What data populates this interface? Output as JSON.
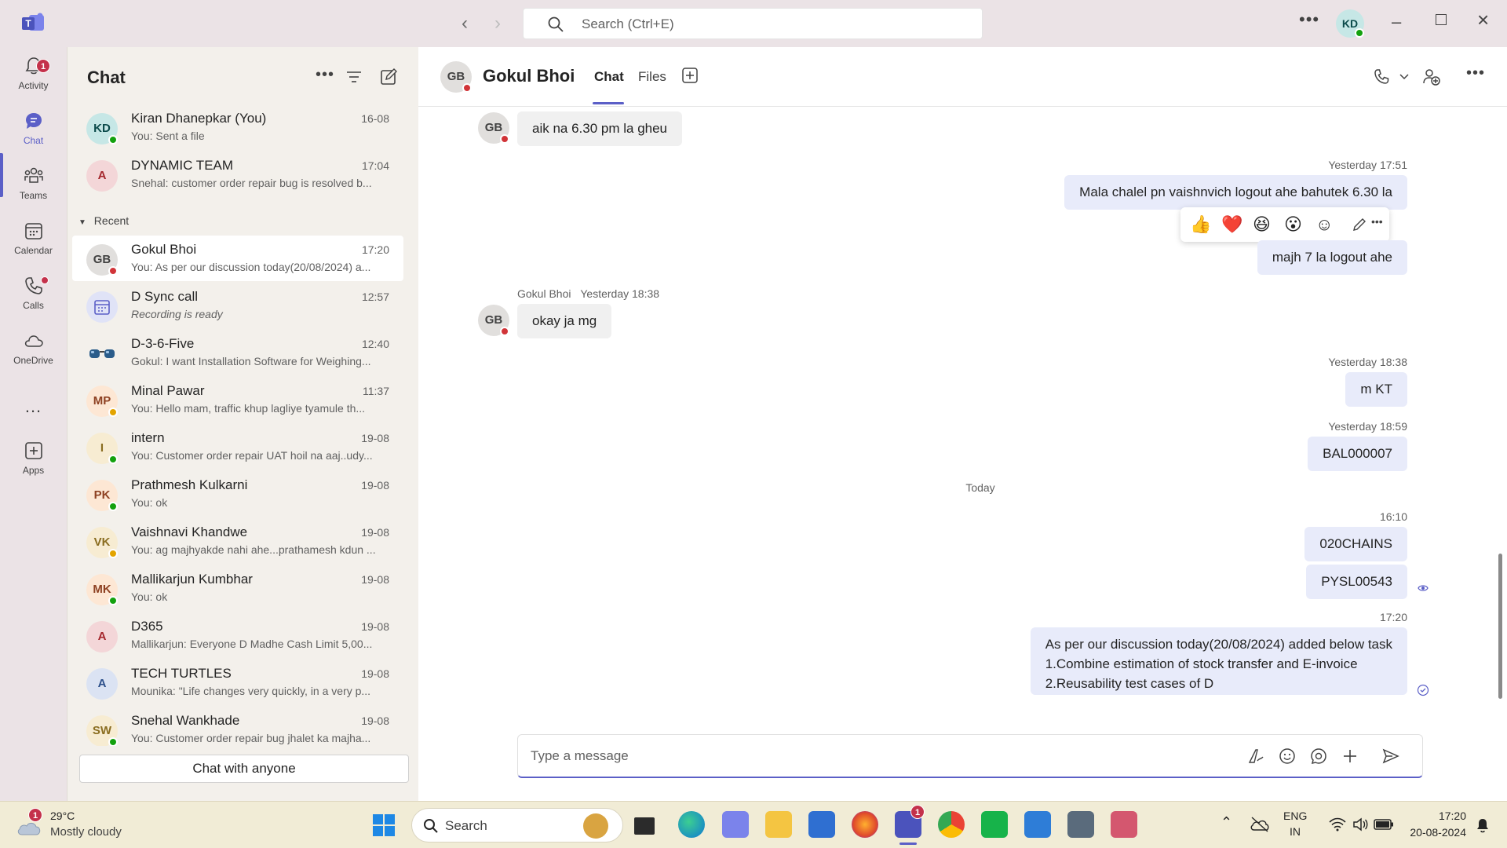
{
  "titlebar": {
    "search_placeholder": "Search (Ctrl+E)",
    "user_initials": "KD"
  },
  "rail": {
    "items": [
      {
        "label": "Activity",
        "badge": "1"
      },
      {
        "label": "Chat"
      },
      {
        "label": "Teams"
      },
      {
        "label": "Calendar"
      },
      {
        "label": "Calls"
      },
      {
        "label": "OneDrive"
      },
      {
        "label": "..."
      },
      {
        "label": "Apps"
      }
    ]
  },
  "chatlist": {
    "title": "Chat",
    "recent_label": "Recent",
    "chat_with_anyone": "Chat with anyone",
    "pinned": [
      {
        "initials": "KD",
        "name": "Kiran Dhanepkar (You)",
        "time": "16-08",
        "preview": "You: Sent a file"
      },
      {
        "initials": "A",
        "name": "DYNAMIC TEAM",
        "time": "17:04",
        "preview": "Snehal: customer order repair bug is resolved b..."
      }
    ],
    "recent": [
      {
        "initials": "GB",
        "name": "Gokul Bhoi",
        "time": "17:20",
        "preview": "You: As per our discussion today(20/08/2024) a..."
      },
      {
        "initials": "",
        "name": "D Sync call",
        "time": "12:57",
        "preview": "Recording is ready"
      },
      {
        "initials": "",
        "name": "D-3-6-Five",
        "time": "12:40",
        "preview": "Gokul: I want Installation Software for Weighing..."
      },
      {
        "initials": "MP",
        "name": "Minal Pawar",
        "time": "11:37",
        "preview": "You: Hello mam, traffic khup lagliye tyamule th..."
      },
      {
        "initials": "I",
        "name": "intern",
        "time": "19-08",
        "preview": "You: Customer order repair UAT hoil na aaj..udy..."
      },
      {
        "initials": "PK",
        "name": "Prathmesh Kulkarni",
        "time": "19-08",
        "preview": "You: ok"
      },
      {
        "initials": "VK",
        "name": "Vaishnavi Khandwe",
        "time": "19-08",
        "preview": "You: ag majhyakde nahi ahe...prathamesh kdun ..."
      },
      {
        "initials": "MK",
        "name": "Mallikarjun Kumbhar",
        "time": "19-08",
        "preview": "You: ok"
      },
      {
        "initials": "A",
        "name": "D365",
        "time": "19-08",
        "preview": "Mallikarjun: Everyone D Madhe Cash Limit  5,00..."
      },
      {
        "initials": "A",
        "name": "TECH TURTLES",
        "time": "19-08",
        "preview": "Mounika: \"Life changes very quickly, in a very p..."
      },
      {
        "initials": "SW",
        "name": "Snehal Wankhade",
        "time": "19-08",
        "preview": "You: Customer order repair bug jhalet ka majha..."
      }
    ]
  },
  "conversation": {
    "initials": "GB",
    "name": "Gokul Bhoi",
    "tabs": [
      "Chat",
      "Files"
    ],
    "messages": {
      "m1": "aik na 6.30 pm la gheu",
      "t2": "Yesterday 17:51",
      "m2": "Mala chalel pn vaishnvich logout ahe bahutek 6.30 la",
      "m3": "majh 7 la logout ahe",
      "sender4": "Gokul Bhoi",
      "t4": "Yesterday 18:38",
      "m4": "okay ja mg",
      "t5": "Yesterday 18:38",
      "m5": "m KT",
      "t6": "Yesterday 18:59",
      "m6": "BAL000007",
      "day": "Today",
      "t7": "16:10",
      "m7": "020CHAINS",
      "m8": "PYSL00543",
      "t9": "17:20",
      "m9_line1": "As per our discussion today(20/08/2024) added below task",
      "m9_line2": "1.Combine estimation of stock transfer and E-invoice",
      "m9_line3": "2.Reusability test cases of D"
    },
    "compose_placeholder": "Type a message"
  },
  "taskbar": {
    "weather_badge": "1",
    "temperature": "29°C",
    "weather": "Mostly cloudy",
    "search_label": "Search",
    "teams_badge": "1",
    "lang_line1": "ENG",
    "lang_line2": "IN",
    "time": "17:20",
    "date": "20-08-2024"
  },
  "colors": {
    "accent": "#5b5fc7",
    "outgoing_bubble": "#e8ebfa",
    "incoming_bubble": "#f0f0f0",
    "badge": "#c4314b",
    "presence_available": "#13a10e",
    "presence_busy": "#d13438",
    "presence_away": "#e3a400"
  }
}
